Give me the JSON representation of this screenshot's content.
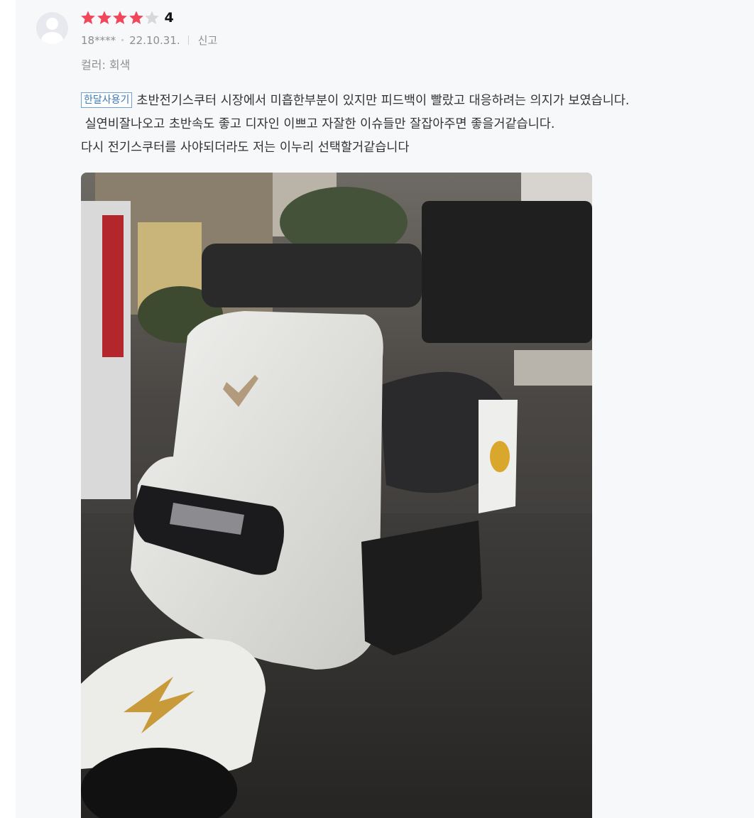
{
  "review": {
    "rating": 4,
    "rating_max": 5,
    "rating_label": "4",
    "user": "18****",
    "date": "22.10.31.",
    "report_label": "신고",
    "option_text": "컬러: 회색",
    "tag": "한달사용기",
    "lines": [
      "초반전기스쿠터 시장에서 미흡한부분이 있지만 피드백이 빨랐고 대응하려는 의지가 보였습니다.",
      " 실연비잘나오고 초반속도 좋고 디자인 이쁘고 자잘한 이슈들만 잘잡아주면 좋을거같습니다.",
      "다시 전기스쿠터를 사야되더라도 저는 이누리 선택할거같습니다"
    ]
  },
  "colors": {
    "star_filled": "#f0475a",
    "star_empty": "#d8d8d8",
    "tag_border": "#6ea1d4",
    "background": "#f7f8fa"
  },
  "icons": {
    "avatar": "default-user-avatar-icon",
    "star": "star-icon"
  }
}
